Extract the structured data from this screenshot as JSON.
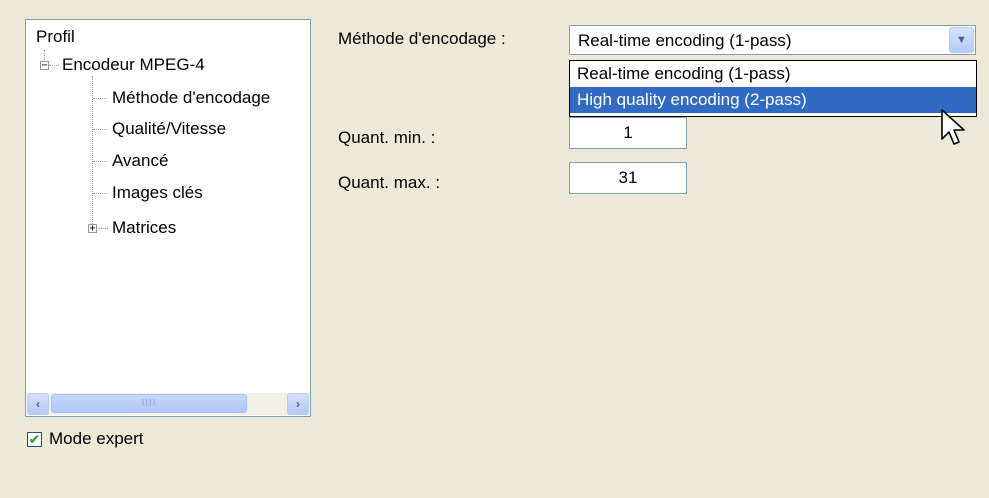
{
  "tree": {
    "root": "Profil",
    "encoder": "Encodeur MPEG-4",
    "children": [
      "Méthode d'encodage",
      "Qualité/Vitesse",
      "Avancé",
      "Images clés"
    ],
    "matrices": "Matrices",
    "expanded_glyph": "−",
    "collapsed_glyph": "+"
  },
  "scrollbar": {
    "left": "‹",
    "right": "›",
    "grip": "IIII"
  },
  "expert": {
    "label": "Mode expert",
    "checked": "✔"
  },
  "encoding": {
    "label": "Méthode d'encodage :",
    "selected": "Real-time encoding (1-pass)",
    "options": [
      "Real-time encoding (1-pass)",
      "High quality encoding (2-pass)"
    ],
    "arrow": "▼"
  },
  "quant": {
    "min_label": "Quant. min. :",
    "min_value": "1",
    "max_label": "Quant. max. :",
    "max_value": "31"
  },
  "colors": {
    "highlight": "#316AC5",
    "background": "#ECE9D8"
  }
}
